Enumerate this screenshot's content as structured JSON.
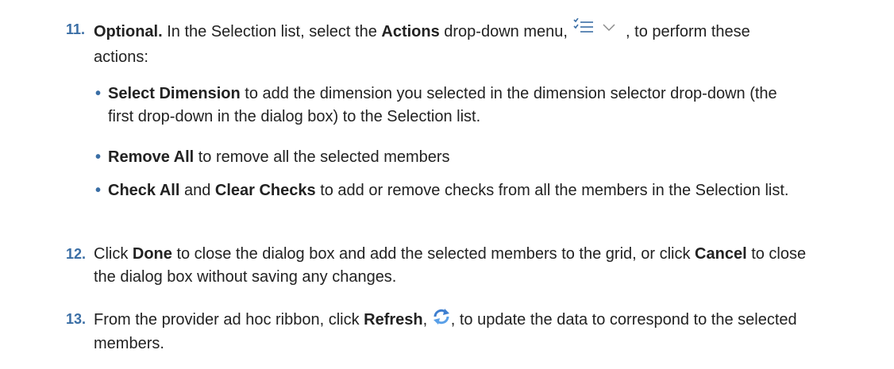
{
  "steps": [
    {
      "number": "11.",
      "prefix_bold": "Optional.",
      "t1": " In the Selection list, select the ",
      "bold1": "Actions",
      "t2": " drop-down menu, ",
      "icon": "actions-menu-icon",
      "t3": " , to perform these actions:"
    },
    {
      "number": "12.",
      "t1": "Click ",
      "bold1": "Done",
      "t2": " to close the dialog box and add the selected members to the grid, or click ",
      "bold2": "Cancel",
      "t3": " to close the dialog box without saving any changes."
    },
    {
      "number": "13.",
      "t1": "From the provider ad hoc ribbon, click ",
      "bold1": "Refresh",
      "t2": ", ",
      "icon": "refresh-icon",
      "t3": ", to update the data to correspond to the selected members."
    }
  ],
  "bullets": [
    {
      "marker": "•",
      "bold1": "Select Dimension",
      "t1": " to add the dimension you selected in the dimension selector drop-down (the first drop-down in the dialog box) to the Selection list."
    },
    {
      "marker": "•",
      "bold1": "Remove All",
      "t1": " to remove all the selected members"
    },
    {
      "marker": "•",
      "bold1": "Check All",
      "t1": " and ",
      "bold2": "Clear Checks",
      "t2": " to add or remove checks from all the members in the Selection list."
    }
  ],
  "colors": {
    "numbering": "#3a6ea5",
    "text": "#222222"
  }
}
